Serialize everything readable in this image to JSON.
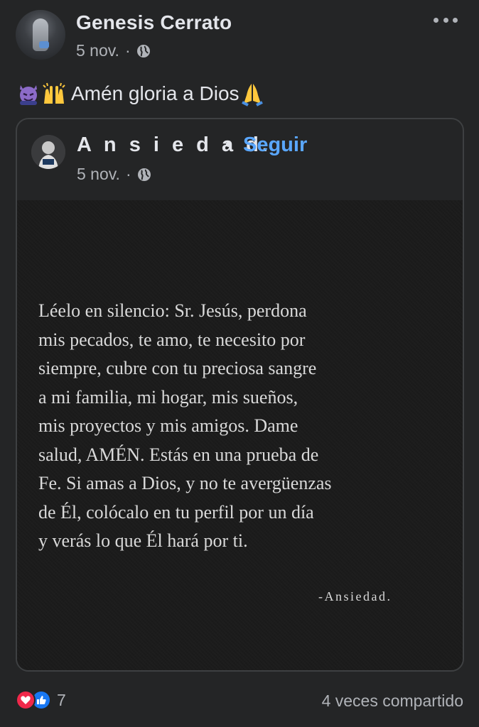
{
  "post": {
    "author_name": "Genesis Cerrato",
    "date": "5 nov.",
    "privacy_icon": "globe-icon",
    "caption": "Amén gloria a Dios",
    "caption_emojis": [
      "devil-emoji",
      "raising-hands-emoji",
      "folded-hands-emoji"
    ]
  },
  "shared": {
    "page_name": "A n s i e d a d.",
    "separator": "•",
    "follow_label": "Seguir",
    "date": "5 nov.",
    "privacy_icon": "globe-icon",
    "quote_lines": [
      "Léelo en silencio: Sr. Jesús, perdona",
      "mis pecados, te amo, te necesito por",
      "siempre, cubre con tu preciosa sangre",
      "a mi familia, mi hogar, mis sueños,",
      "mis proyectos y mis amigos. Dame",
      "salud, AMÉN. Estás en una prueba de",
      "Fe. Si amas a Dios, y no te avergüenzas",
      "de Él, colócalo en tu perfil por un día",
      "y verás lo que Él hará por ti."
    ],
    "signature": "-Ansiedad."
  },
  "footer": {
    "reaction_icons": [
      "love-reaction-icon",
      "like-reaction-icon"
    ],
    "reaction_count": "7",
    "shares_text": "4 veces compartido"
  },
  "colors": {
    "background": "#242526",
    "text_primary": "#e4e6eb",
    "text_secondary": "#b0b3b8",
    "follow_link": "#5aa7ff",
    "love": "#f0284a",
    "like": "#1877f2"
  }
}
